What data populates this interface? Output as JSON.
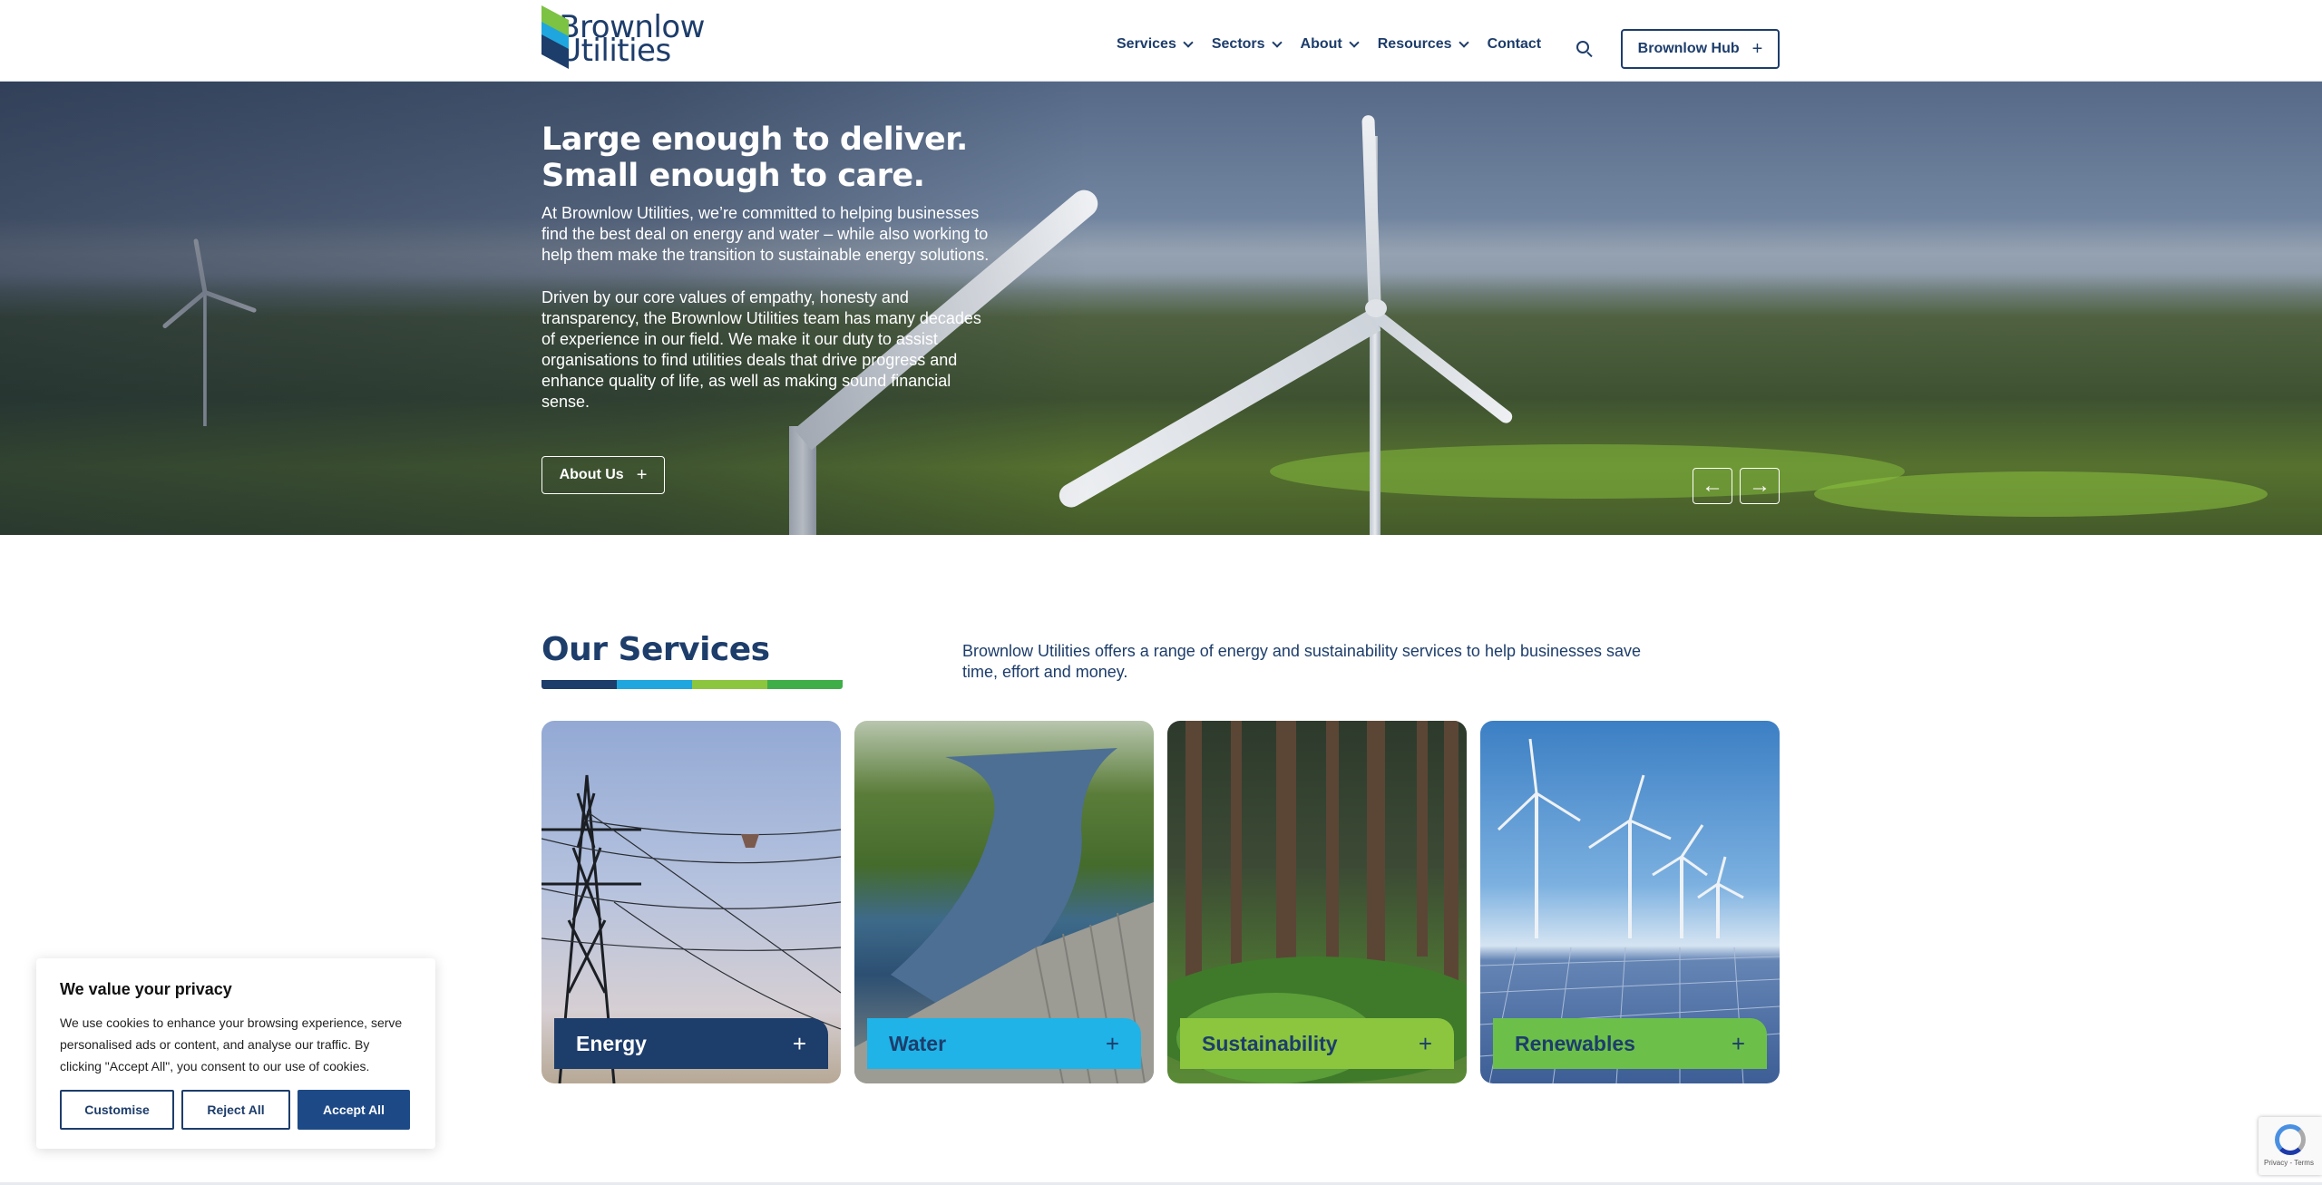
{
  "header": {
    "logo": {
      "line1": "Brownlow",
      "line2": "Utilities"
    },
    "nav": [
      {
        "label": "Services",
        "dropdown": true
      },
      {
        "label": "Sectors",
        "dropdown": true
      },
      {
        "label": "About",
        "dropdown": true
      },
      {
        "label": "Resources",
        "dropdown": true
      },
      {
        "label": "Contact",
        "dropdown": false
      }
    ],
    "search_icon": "search-icon",
    "hub_button": {
      "label": "Brownlow Hub",
      "icon": "plus-icon"
    }
  },
  "hero": {
    "title_line1": "Large enough to deliver.",
    "title_line2": "Small enough to care.",
    "paragraph1": "At Brownlow Utilities, we’re committed to helping businesses find the best deal on energy and water – while also working to help them make the transition to sustainable energy solutions.",
    "paragraph2": "Driven by our core values of empathy, honesty and transparency, the Brownlow Utilities team has many decades of experience in our field. We make it our duty to assist organisations to find utilities deals that drive progress and enhance quality of life, as well as making sound financial sense.",
    "cta": {
      "label": "About Us",
      "icon": "plus-icon"
    },
    "prev_icon": "arrow-left-icon",
    "next_icon": "arrow-right-icon"
  },
  "services": {
    "title": "Our Services",
    "description": "Brownlow Utilities offers a range of energy and sustainability services to help businesses save time, effort and money.",
    "bar_colors": [
      "#1d3d6b",
      "#1fa6de",
      "#8cc63f",
      "#3fae49"
    ],
    "cards": [
      {
        "label": "Energy",
        "label_bg": "#1d3d6b",
        "label_color": "#ffffff"
      },
      {
        "label": "Water",
        "label_bg": "#1fb3e8",
        "label_color": "#1d3d6b"
      },
      {
        "label": "Sustainability",
        "label_bg": "#8cc63f",
        "label_color": "#1d3d6b"
      },
      {
        "label": "Renewables",
        "label_bg": "#6cc04a",
        "label_color": "#1d3d6b"
      }
    ]
  },
  "cookie": {
    "title": "We value your privacy",
    "text": "We use cookies to enhance your browsing experience, serve personalised ads or content, and analyse our traffic. By clicking \"Accept All\", you consent to our use of cookies.",
    "buttons": {
      "customise": "Customise",
      "reject": "Reject All",
      "accept": "Accept All"
    }
  },
  "recaptcha": {
    "text": "Privacy - Terms"
  }
}
